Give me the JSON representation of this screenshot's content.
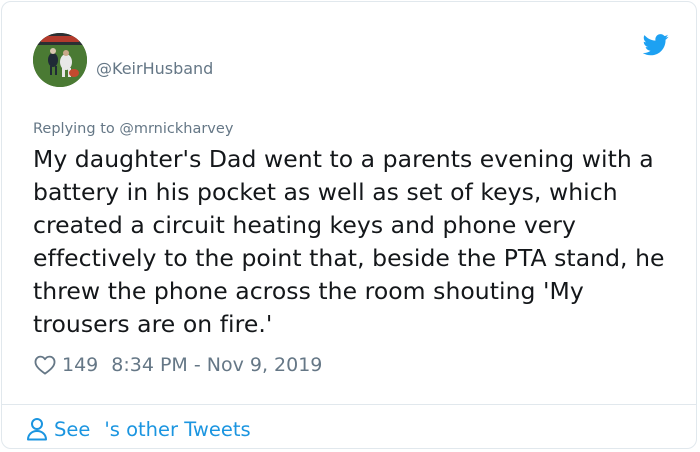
{
  "tweet": {
    "handle": "@KeirHusband",
    "replying_to": "Replying to @mrnickharvey",
    "text": "My daughter's Dad went to a parents evening with a battery in his pocket as well as set of keys, which created a circuit heating keys and phone very effectively to the point that, beside the PTA stand, he threw the phone across the room shouting 'My trousers are on fire.'",
    "like_count": "149",
    "timestamp": "8:34 PM - Nov 9, 2019"
  },
  "footer": {
    "see_label": "See",
    "other_tweets_label": "'s other Tweets"
  },
  "icons": {
    "brand": "twitter-bird-icon",
    "like": "heart-icon",
    "profile": "person-icon"
  },
  "colors": {
    "brand_blue": "#1da1f2",
    "link_blue": "#1b95e0",
    "text": "#14171a",
    "muted": "#657786",
    "border": "#e1e8ed"
  }
}
